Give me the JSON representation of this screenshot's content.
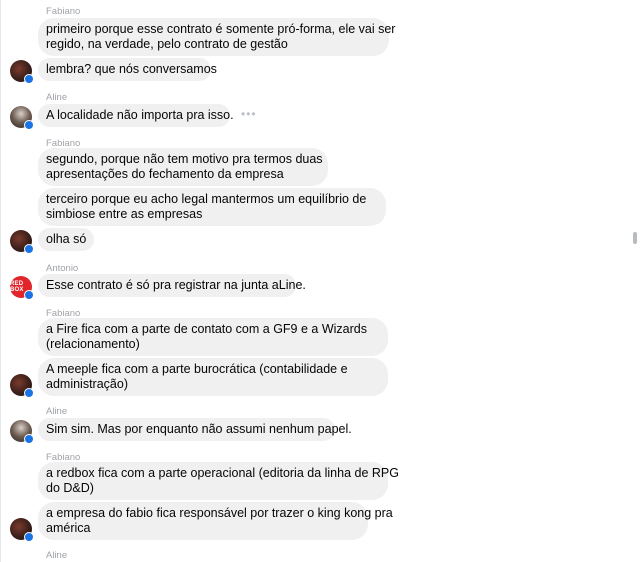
{
  "messages": [
    {
      "sender": "Fabiano",
      "lines": [
        "primeiro porque esse contrato é somente pró-forma, ele vai ser",
        "regido, na verdade, pelo contrato de gestão"
      ]
    },
    {
      "lines": [
        "lembra? que nós conversamos"
      ]
    },
    {
      "sender": "Aline",
      "lines": [
        "A localidade não importa pra isso."
      ]
    },
    {
      "sender": "Fabiano",
      "lines": [
        "segundo, porque não tem motivo pra termos duas",
        "apresentações do fechamento da empresa"
      ]
    },
    {
      "lines": [
        "terceiro porque eu acho legal mantermos um equilíbrio de",
        "simbiose entre as empresas"
      ]
    },
    {
      "lines": [
        "olha só"
      ]
    },
    {
      "sender": "Antonio",
      "lines": [
        "Esse contrato é só pra registrar na junta aLine."
      ]
    },
    {
      "sender": "Fabiano",
      "lines": [
        "a Fire fica com a parte de contato com a GF9 e a Wizards",
        "(relacionamento)"
      ]
    },
    {
      "lines": [
        "A meeple fica com a parte burocrática (contabilidade e",
        "administração)"
      ]
    },
    {
      "sender": "Aline",
      "lines": [
        "Sim sim. Mas por enquanto não assumi nenhum papel."
      ]
    },
    {
      "sender": "Fabiano",
      "lines": [
        "a redbox fica com a parte operacional (editoria da linha de RPG",
        "do D&D)"
      ]
    },
    {
      "lines": [
        "a empresa do fabio fica responsável por trazer o king kong pra",
        "américa"
      ]
    },
    {
      "sender": "Aline",
      "lines": []
    }
  ],
  "antonio_avatar_text": "RED BOX",
  "message_actions_icon": "more-dots-icon",
  "colors": {
    "bubble": "#f0f0f0",
    "sender_name": "#a0a3a8",
    "badge": "#1b74e4"
  }
}
